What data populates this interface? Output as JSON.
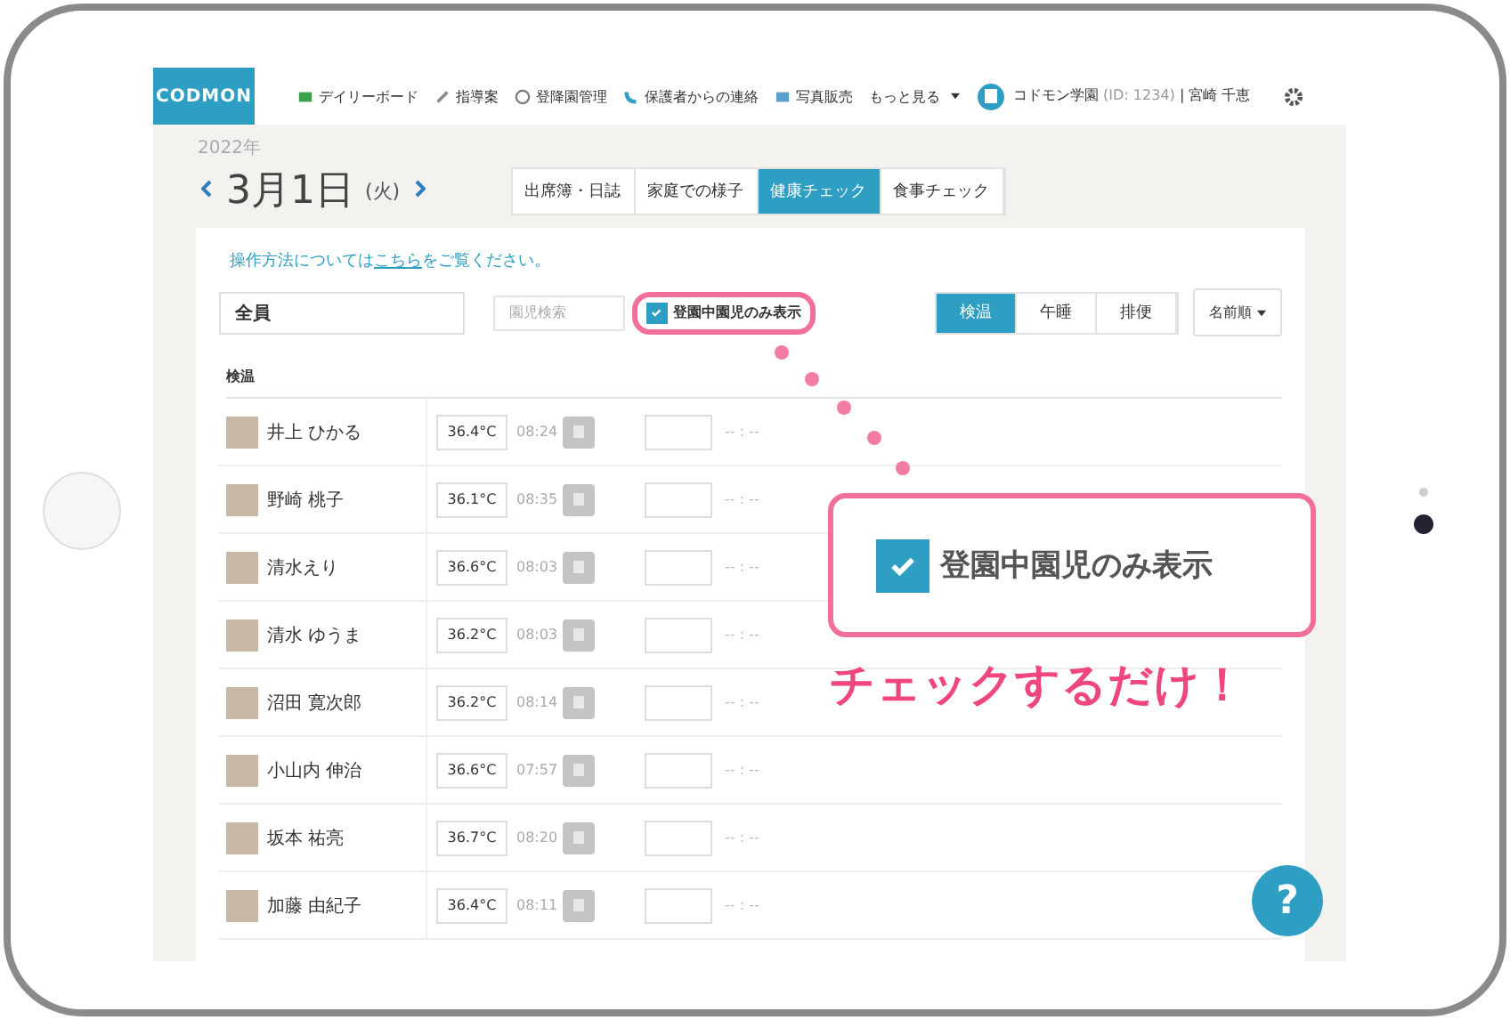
{
  "nav": {
    "logo": "CODMON",
    "items": [
      {
        "label": "デイリーボード"
      },
      {
        "label": "指導案"
      },
      {
        "label": "登降園管理"
      },
      {
        "label": "保護者からの連絡"
      },
      {
        "label": "写真販売"
      }
    ],
    "more": "もっと見る",
    "school": "コドモン学園",
    "school_id": "(ID: 1234)",
    "user": "| 宮崎 千恵"
  },
  "date": {
    "year": "2022年",
    "day": "3月1日",
    "weekday": "(火)"
  },
  "tabs": [
    {
      "label": "出席簿・日誌",
      "selected": false
    },
    {
      "label": "家庭での様子",
      "selected": false
    },
    {
      "label": "健康チェック",
      "selected": true
    },
    {
      "label": "食事チェック",
      "selected": false
    }
  ],
  "help_text": {
    "before": "操作方法については",
    "link": "こちら",
    "after": "をご覧ください。"
  },
  "group": "全員",
  "search": {
    "placeholder": "園児検索"
  },
  "filter": {
    "label": "登園中園児のみ表示",
    "checked": true
  },
  "segments": [
    {
      "label": "検温",
      "selected": true
    },
    {
      "label": "午睡",
      "selected": false
    },
    {
      "label": "排便",
      "selected": false
    }
  ],
  "sort": "名前順",
  "section": "検温",
  "rows": [
    {
      "name": "井上 ひかる",
      "temperature": "36.4°C",
      "time": "08:24",
      "second_time": "-- : --"
    },
    {
      "name": "野崎 桃子",
      "temperature": "36.1°C",
      "time": "08:35",
      "second_time": "-- : --"
    },
    {
      "name": "清水えり",
      "temperature": "36.6°C",
      "time": "08:03",
      "second_time": "-- : --"
    },
    {
      "name": "清水 ゆうま",
      "temperature": "36.2°C",
      "time": "08:03",
      "second_time": "-- : --"
    },
    {
      "name": "沼田 寛次郎",
      "temperature": "36.2°C",
      "time": "08:14",
      "second_time": "-- : --"
    },
    {
      "name": "小山内 伸治",
      "temperature": "36.6°C",
      "time": "07:57",
      "second_time": "-- : --"
    },
    {
      "name": "坂本 祐亮",
      "temperature": "36.7°C",
      "time": "08:20",
      "second_time": "-- : --"
    },
    {
      "name": "加藤 由紀子",
      "temperature": "36.4°C",
      "time": "08:11",
      "second_time": "-- : --"
    }
  ],
  "callout": {
    "checkbox": {
      "label": "登園中園児のみ表示",
      "checked": true
    },
    "caption": "チェックするだけ！"
  },
  "help_button": "?"
}
